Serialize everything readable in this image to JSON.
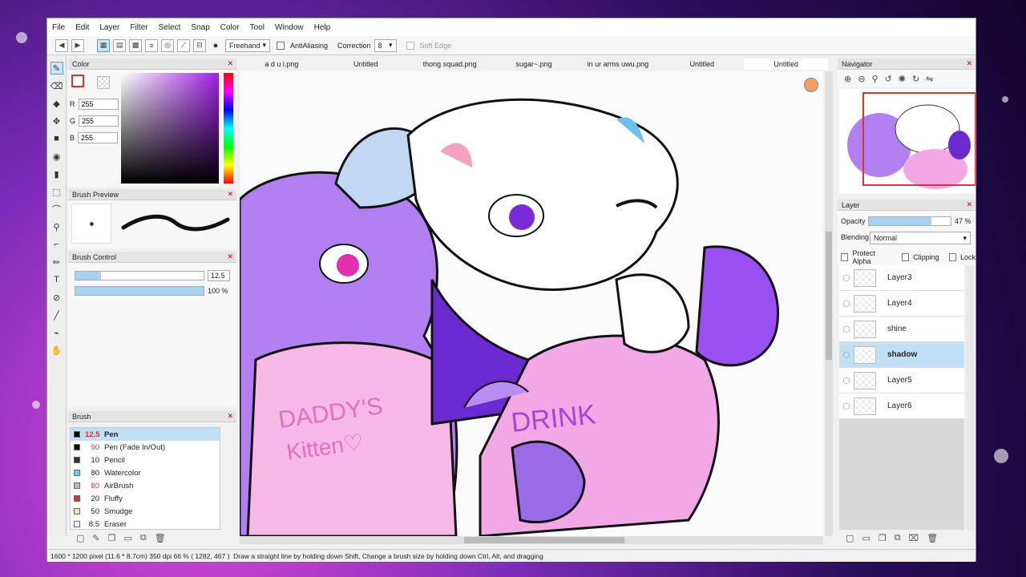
{
  "menu": [
    "File",
    "Edit",
    "Layer",
    "Filter",
    "Select",
    "Snap",
    "Color",
    "Tool",
    "Window",
    "Help"
  ],
  "toolbar": {
    "stroke_mode": "Freehand",
    "antialiasing_label": "AntiAliasing",
    "correction_label": "Correction",
    "correction_value": "8",
    "soft_edge_label": "Soft Edge"
  },
  "color_panel": {
    "title": "Color",
    "r_label": "R",
    "r_value": "255",
    "g_label": "G",
    "g_value": "255",
    "b_label": "B",
    "b_value": "255"
  },
  "brush_preview": {
    "title": "Brush Preview"
  },
  "brush_control": {
    "title": "Brush Control",
    "size_value": "12.5",
    "opacity_value": "100 %",
    "size_fraction": 0.2,
    "opacity_fraction": 1.0
  },
  "brush_panel": {
    "title": "Brush",
    "items": [
      {
        "size": "12.5",
        "name": "Pen",
        "color": "#000000",
        "size_color": "#e03030",
        "selected": true
      },
      {
        "size": "90",
        "name": "Pen (Fade In/Out)",
        "color": "#000000",
        "size_color": "#e03030",
        "selected": false
      },
      {
        "size": "10",
        "name": "Pencil",
        "color": "#333333",
        "size_color": "#222222",
        "selected": false
      },
      {
        "size": "80",
        "name": "Watercolor",
        "color": "#5fd0f0",
        "size_color": "#222222",
        "selected": false
      },
      {
        "size": "80",
        "name": "AirBrush",
        "color": "#bbbbbb",
        "size_color": "#e03030",
        "selected": false
      },
      {
        "size": "20",
        "name": "Fluffy",
        "color": "#e03030",
        "size_color": "#222222",
        "selected": false
      },
      {
        "size": "50",
        "name": "Smudge",
        "color": "#f0e0c0",
        "size_color": "#222222",
        "selected": false
      },
      {
        "size": "8.5",
        "name": "Eraser",
        "color": "#ffffff",
        "size_color": "#222222",
        "selected": false
      }
    ]
  },
  "tabs": [
    {
      "label": "a d u l.png",
      "active": false
    },
    {
      "label": "Untitled",
      "active": false
    },
    {
      "label": "thong squad.png",
      "active": false
    },
    {
      "label": "sugar~.png",
      "active": false
    },
    {
      "label": "in ur arms uwu.png",
      "active": false
    },
    {
      "label": "Untitled",
      "active": false
    },
    {
      "label": "Untitled",
      "active": true
    }
  ],
  "navigator": {
    "title": "Navigator"
  },
  "layer_panel": {
    "title": "Layer",
    "opacity_label": "Opacity",
    "opacity_value": "47 %",
    "opacity_fraction": 0.76,
    "blending_label": "Blending",
    "blending_value": "Normal",
    "protect_alpha": "Protect Alpha",
    "clipping": "Clipping",
    "lock": "Lock",
    "layers": [
      {
        "name": "Layer3",
        "selected": false
      },
      {
        "name": "Layer4",
        "selected": false
      },
      {
        "name": "shine",
        "selected": false
      },
      {
        "name": "shadow",
        "selected": true
      },
      {
        "name": "Layer5",
        "selected": false
      },
      {
        "name": "Layer6",
        "selected": false
      }
    ]
  },
  "canvas_text": {
    "sweater_left": "DADDY'S",
    "sweater_left_2": "Kitten♡",
    "sweater_right": "DRINK"
  },
  "status": {
    "dimensions": "1600 * 1200 pixel",
    "physical": "(11.6 * 8.7cm)",
    "dpi": "350 dpi",
    "zoom": "66 %",
    "cursor": "( 1282, 467 )",
    "hint": "Draw a straight line by holding down Shift, Change a brush size by holding down Ctrl, Alt, and dragging"
  },
  "colors": {
    "accent": "#a8d2ef",
    "selection": "#bfe0f7",
    "purple": "#b27ff0",
    "pink": "#f6b8e4"
  }
}
